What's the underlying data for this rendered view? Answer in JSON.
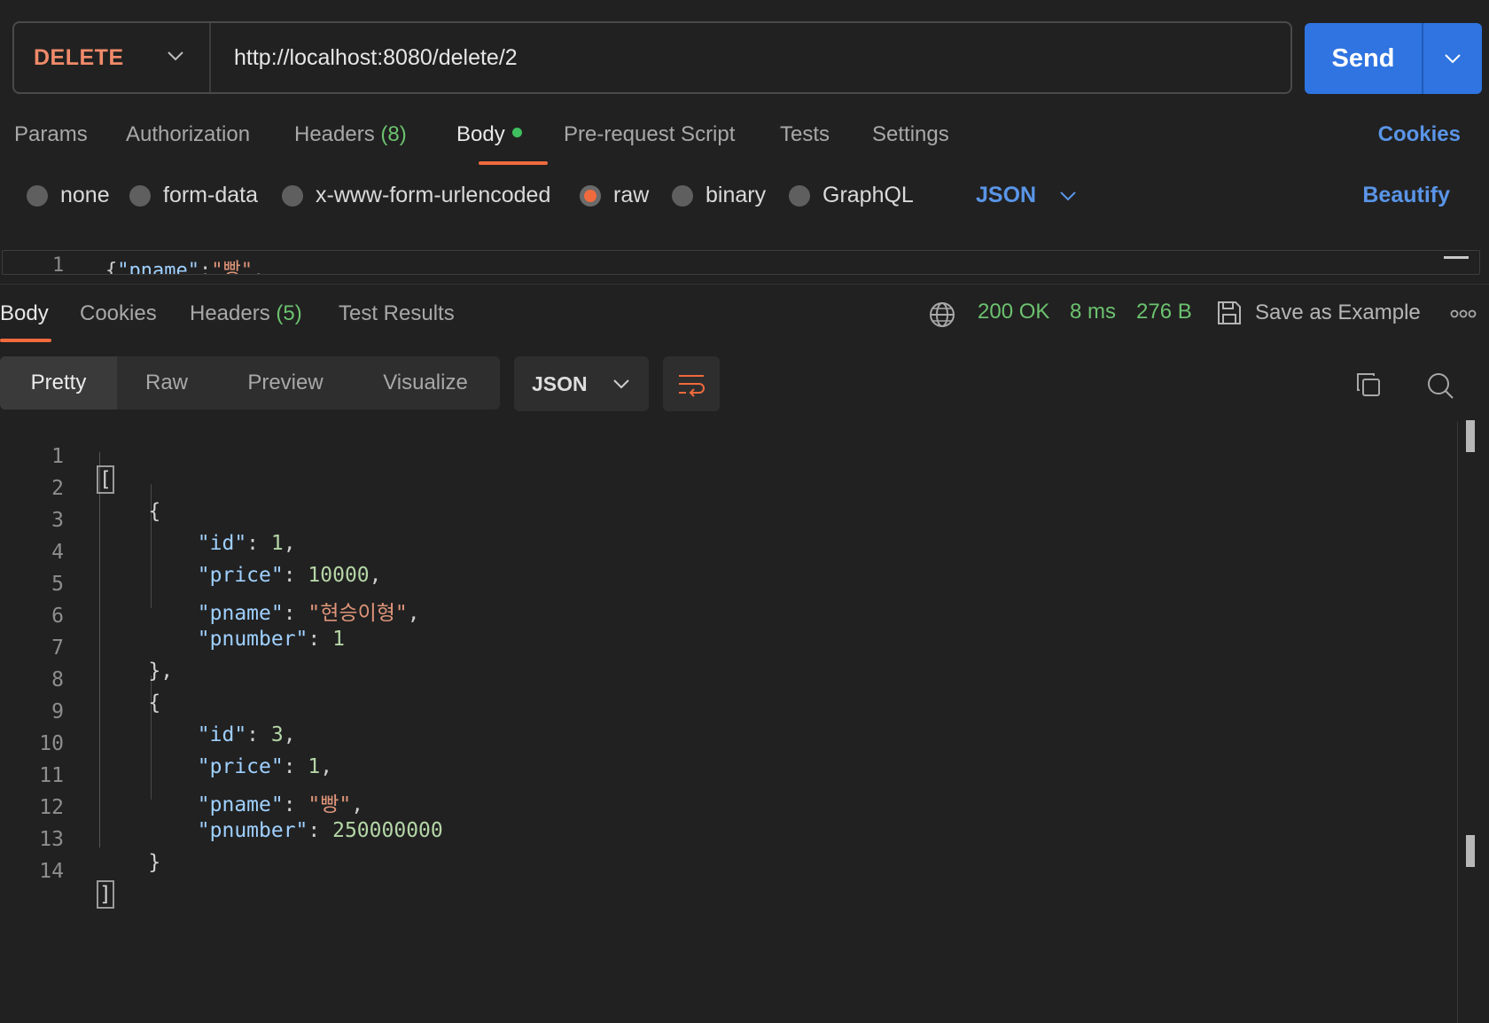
{
  "request": {
    "method": "DELETE",
    "url": "http://localhost:8080/delete/2",
    "send_label": "Send"
  },
  "req_tabs": {
    "params": "Params",
    "authorization": "Authorization",
    "headers": "Headers",
    "headers_count": "(8)",
    "body": "Body",
    "prerequest": "Pre-request Script",
    "tests": "Tests",
    "settings": "Settings",
    "cookies": "Cookies"
  },
  "body_types": {
    "none": "none",
    "form_data": "form-data",
    "urlencoded": "x-www-form-urlencoded",
    "raw": "raw",
    "binary": "binary",
    "graphql": "GraphQL",
    "selected": "raw",
    "format": "JSON",
    "beautify": "Beautify"
  },
  "req_editor": {
    "line": "1",
    "brace": "{",
    "key": "\"pname\"",
    "colon": ":",
    "value": "\"빵\"",
    "trail": ","
  },
  "res_tabs": {
    "body": "Body",
    "cookies": "Cookies",
    "headers": "Headers",
    "headers_count": "(5)",
    "test_results": "Test Results"
  },
  "status": {
    "code": "200 OK",
    "time": "8 ms",
    "size": "276 B",
    "save_example": "Save as Example"
  },
  "view_modes": {
    "pretty": "Pretty",
    "raw": "Raw",
    "preview": "Preview",
    "visualize": "Visualize",
    "format": "JSON"
  },
  "response_lines": [
    {
      "num": "1"
    },
    {
      "num": "2"
    },
    {
      "num": "3",
      "key": "\"id\"",
      "val": "1",
      "type": "n",
      "comma": ","
    },
    {
      "num": "4",
      "key": "\"price\"",
      "val": "10000",
      "type": "n",
      "comma": ","
    },
    {
      "num": "5",
      "key": "\"pname\"",
      "val": "\"현승이형\"",
      "type": "s",
      "comma": ","
    },
    {
      "num": "6",
      "key": "\"pnumber\"",
      "val": "1",
      "type": "n",
      "comma": ""
    },
    {
      "num": "7"
    },
    {
      "num": "8"
    },
    {
      "num": "9",
      "key": "\"id\"",
      "val": "3",
      "type": "n",
      "comma": ","
    },
    {
      "num": "10",
      "key": "\"price\"",
      "val": "1",
      "type": "n",
      "comma": ","
    },
    {
      "num": "11",
      "key": "\"pname\"",
      "val": "\"빵\"",
      "type": "s",
      "comma": ","
    },
    {
      "num": "12",
      "key": "\"pnumber\"",
      "val": "250000000",
      "type": "n",
      "comma": ""
    },
    {
      "num": "13"
    },
    {
      "num": "14"
    }
  ],
  "colors": {
    "method": "#f08a6a",
    "send": "#2f74e0",
    "accent": "#f06a3d",
    "link": "#5a95e8",
    "status_ok": "#6cc26f"
  },
  "icons": [
    "chevron-down-icon",
    "globe-icon",
    "save-icon",
    "more-icon",
    "wrap-icon",
    "copy-icon",
    "search-icon"
  ]
}
